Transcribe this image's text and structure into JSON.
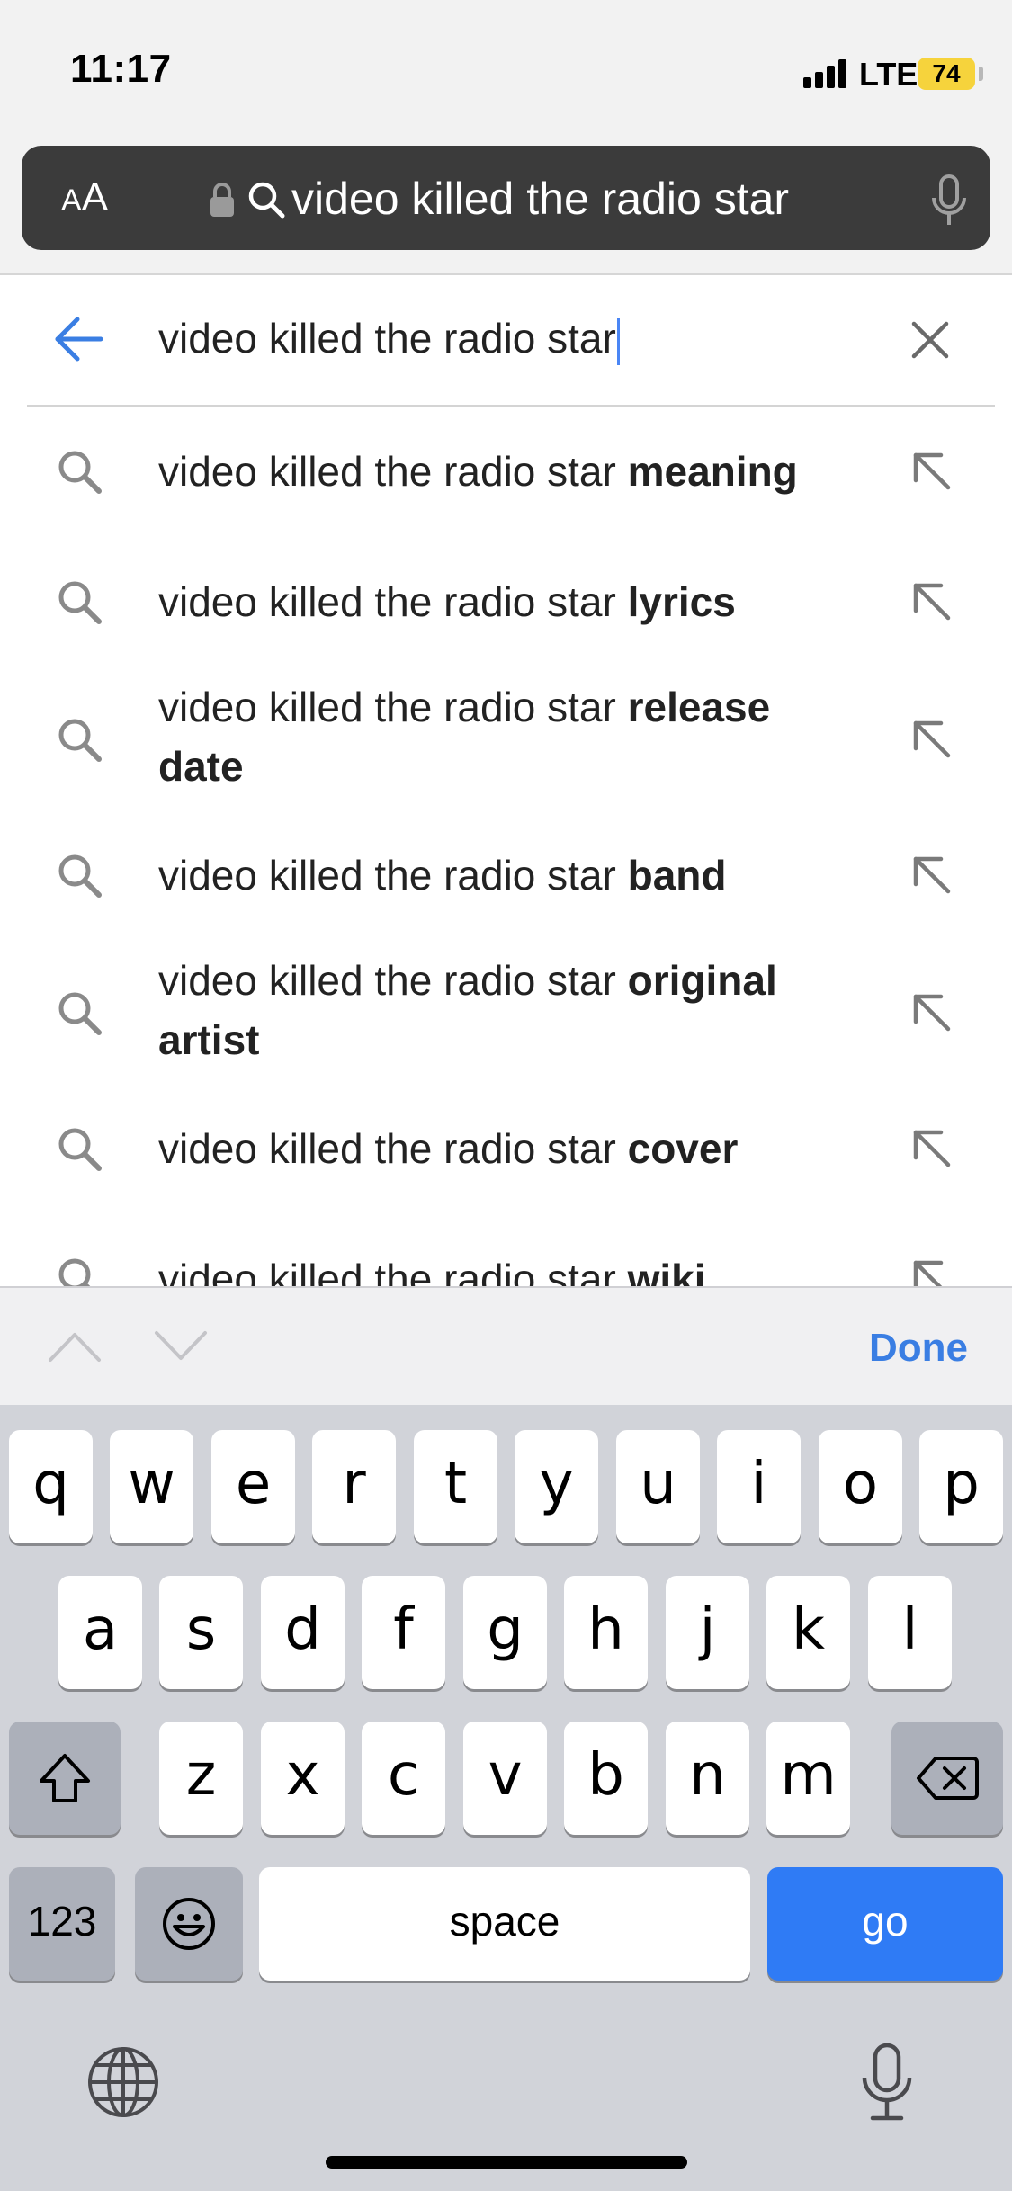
{
  "status_bar": {
    "time": "11:17",
    "network": "LTE",
    "battery": "74"
  },
  "url_bar": {
    "aa_small": "A",
    "aa_big": "A",
    "url_text": "video killed the radio star"
  },
  "search": {
    "query": "video killed the radio star"
  },
  "suggestions": [
    {
      "prefix": "video killed the radio star ",
      "bold": "meaning"
    },
    {
      "prefix": "video killed the radio star ",
      "bold": "lyrics"
    },
    {
      "prefix": "video killed the radio star ",
      "bold": "release date"
    },
    {
      "prefix": "video killed the radio star ",
      "bold": "band"
    },
    {
      "prefix": "video killed the radio star ",
      "bold": "original artist"
    },
    {
      "prefix": "video killed the radio star ",
      "bold": "cover"
    },
    {
      "prefix": "video killed the radio star ",
      "bold": "wiki"
    }
  ],
  "accessory": {
    "done_label": "Done"
  },
  "keyboard": {
    "row1": [
      "q",
      "w",
      "e",
      "r",
      "t",
      "y",
      "u",
      "i",
      "o",
      "p"
    ],
    "row2": [
      "a",
      "s",
      "d",
      "f",
      "g",
      "h",
      "j",
      "k",
      "l"
    ],
    "row3": [
      "z",
      "x",
      "c",
      "v",
      "b",
      "n",
      "m"
    ],
    "numbers_label": "123",
    "space_label": "space",
    "go_label": "go"
  },
  "colors": {
    "accent": "#3a7ee3",
    "go_key": "#2f7bf5",
    "url_bar": "#3b3b3b",
    "battery": "#f6d33c"
  }
}
